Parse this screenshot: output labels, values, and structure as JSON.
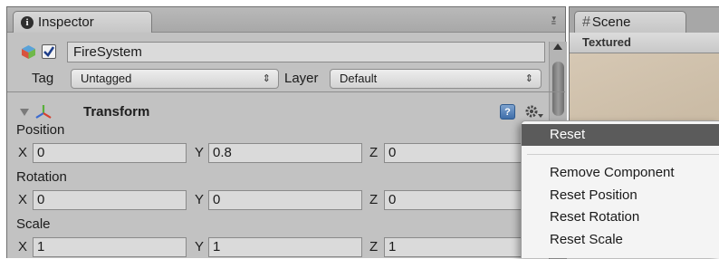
{
  "inspector": {
    "tab_label": "Inspector",
    "game_object": {
      "active": true,
      "name": "FireSystem"
    },
    "tag_label": "Tag",
    "tag_value": "Untagged",
    "layer_label": "Layer",
    "layer_value": "Default",
    "transform": {
      "title": "Transform",
      "position": {
        "label": "Position",
        "x": "0",
        "y": "0.8",
        "z": "0"
      },
      "rotation": {
        "label": "Rotation",
        "x": "0",
        "y": "0",
        "z": "0"
      },
      "scale": {
        "label": "Scale",
        "x": "1",
        "y": "1",
        "z": "1"
      },
      "axis_x": "X",
      "axis_y": "Y",
      "axis_z": "Z"
    }
  },
  "scene": {
    "tab_label": "Scene",
    "shading_mode": "Textured"
  },
  "context_menu": {
    "items": [
      "Reset",
      "Remove Component",
      "Reset Position",
      "Reset Rotation",
      "Reset Scale"
    ],
    "highlighted": "Reset"
  },
  "icons": [
    "info-icon",
    "panel-menu-icon",
    "gameobject-cube-icon",
    "checkbox-check-icon",
    "dropdown-arrow-icon",
    "foldout-arrow-icon",
    "transform-axes-icon",
    "help-icon",
    "gear-icon",
    "hash-icon",
    "scroll-up-arrow-icon"
  ]
}
